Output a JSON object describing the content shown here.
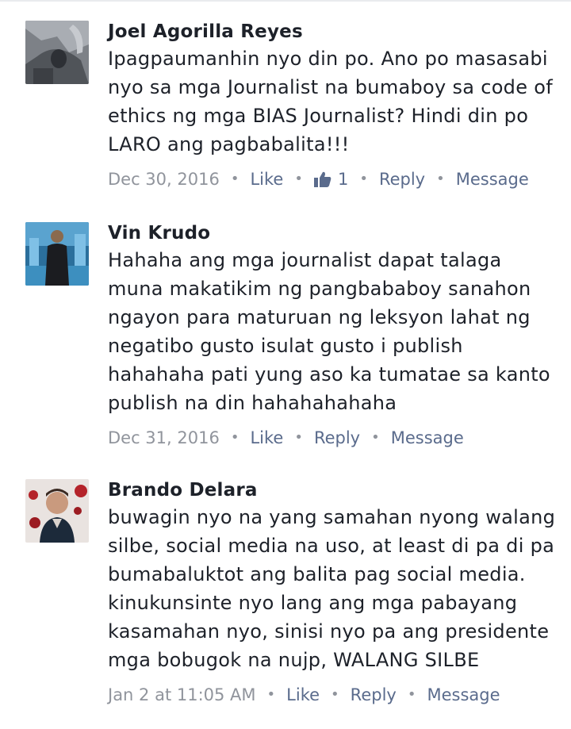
{
  "comments": [
    {
      "author": "Joel Agorilla Reyes",
      "text": "Ipagpaumanhin nyo din po. Ano po masasabi nyo sa mga Journalist na bumaboy sa code of ethics ng mga BIAS Journalist? Hindi din po LARO ang pagbabalita!!!",
      "timestamp": "Dec 30, 2016",
      "like_label": "Like",
      "like_count": "1",
      "reply_label": "Reply",
      "message_label": "Message",
      "avatar_icon": "user-photo"
    },
    {
      "author": "Vin Krudo",
      "text": "Hahaha ang mga journalist dapat talaga muna makatikim ng pangbababoy sanahon ngayon para maturuan ng leksyon lahat ng negatibo gusto isulat gusto i publish hahahaha pati yung aso ka tumatae sa kanto publish na din hahahahahaha",
      "timestamp": "Dec 31, 2016",
      "like_label": "Like",
      "reply_label": "Reply",
      "message_label": "Message",
      "avatar_icon": "user-photo"
    },
    {
      "author": "Brando Delara",
      "text": "buwagin nyo na yang samahan nyong walang silbe, social media na uso, at least di pa di pa bumabaluktot ang balita pag social media. kinukunsinte nyo lang ang mga pabayang kasamahan nyo, sinisi nyo pa ang presidente mga bobugok na nujp, WALANG SILBE",
      "timestamp": "Jan 2 at 11:05 AM",
      "like_label": "Like",
      "reply_label": "Reply",
      "message_label": "Message",
      "avatar_icon": "user-photo"
    }
  ],
  "colors": {
    "author": "#1d2129",
    "body_text": "#1d2129",
    "timestamp": "#90949c",
    "action_link": "#5a6b8c"
  },
  "icons": {
    "thumbs_up": "thumbs-up-icon"
  }
}
